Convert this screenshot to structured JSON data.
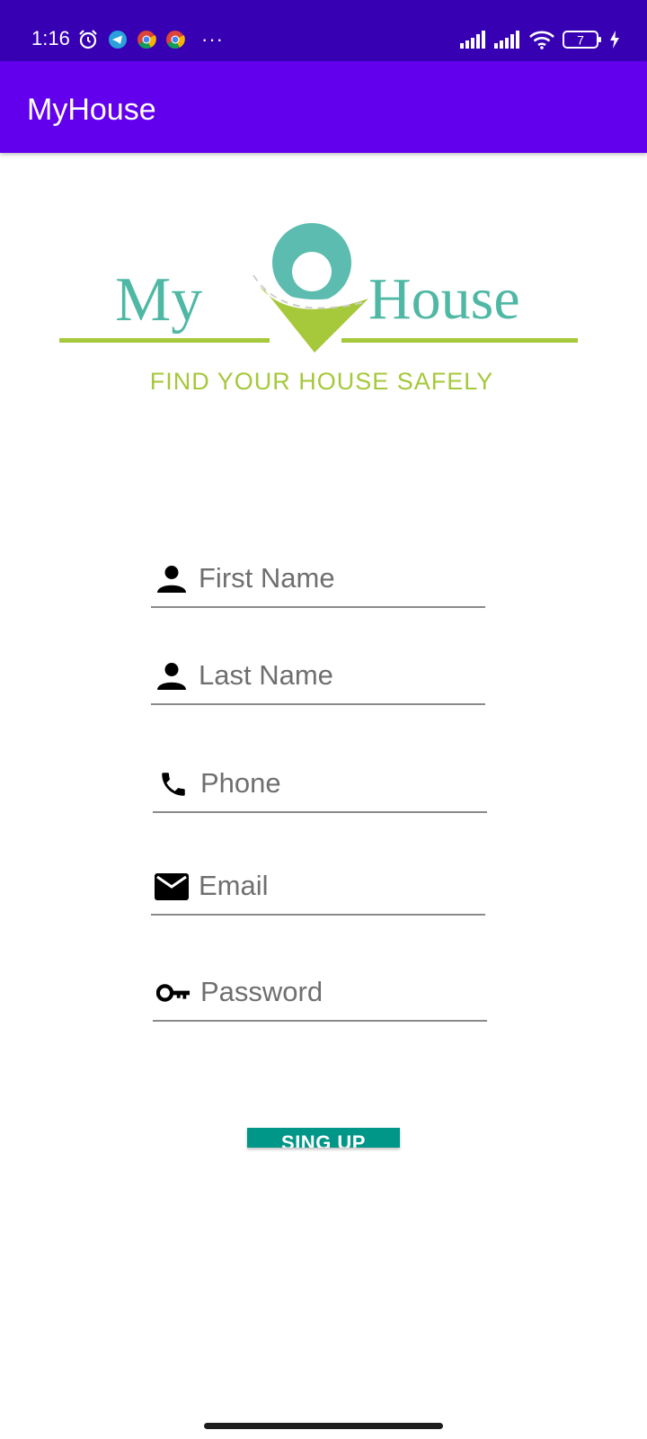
{
  "status_bar": {
    "time": "1:16",
    "left_icons": [
      "alarm-icon",
      "telegram-icon",
      "chrome-icon",
      "chrome-icon",
      "more-dots-icon"
    ],
    "more_glyph": "···",
    "right_icons": [
      "signal-icon",
      "signal-icon",
      "wifi-icon",
      "battery-icon",
      "charging-icon"
    ],
    "battery_level": "7"
  },
  "app_bar": {
    "title": "MyHouse"
  },
  "logo": {
    "word_left": "My",
    "word_right": "House",
    "tagline": "FIND YOUR HOUSE SAFELY",
    "colors": {
      "teal": "#4fb8a4",
      "lime": "#a6c83b"
    }
  },
  "form": {
    "fields": [
      {
        "placeholder": "First Name",
        "value": "",
        "icon": "person-icon"
      },
      {
        "placeholder": "Last Name",
        "value": "",
        "icon": "person-icon"
      },
      {
        "placeholder": "Phone",
        "value": "",
        "icon": "phone-icon"
      },
      {
        "placeholder": "Email",
        "value": "",
        "icon": "email-icon"
      },
      {
        "placeholder": "Password",
        "value": "",
        "icon": "key-icon"
      }
    ],
    "submit_label": "SING UP"
  },
  "colors": {
    "status_bar": "#3700b3",
    "app_bar": "#6200ee",
    "button": "#009688"
  }
}
